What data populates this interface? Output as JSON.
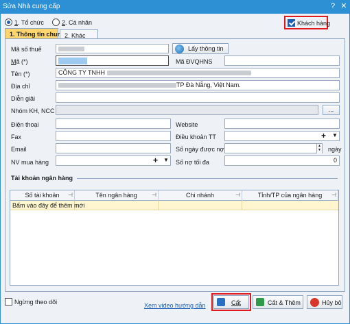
{
  "window": {
    "title": "Sửa Nhà cung cấp",
    "help": "?",
    "close": "✕"
  },
  "type_radio": {
    "option1": {
      "num": "1",
      "text": ". Tổ chức"
    },
    "option2": {
      "num": "2",
      "text": ". Cá nhân"
    }
  },
  "customer_checkbox": {
    "label": "Khách hàng",
    "checked": true
  },
  "tabs": [
    {
      "label": "1. Thông tin chung"
    },
    {
      "label": "2. Khác"
    }
  ],
  "form": {
    "tax_code": {
      "label": "Mã số thuế",
      "value": ""
    },
    "code": {
      "label": "Mã (*)",
      "value": ""
    },
    "lookup_button": "Lấy thông tin",
    "unit_code": {
      "label": "Mã ĐVQHNS",
      "value": ""
    },
    "name": {
      "label": "Tên (*)",
      "value": "CÔNG TY TNHH"
    },
    "address": {
      "label": "Địa chỉ",
      "value": "TP Đà Nẵng, Việt Nam."
    },
    "note": {
      "label": "Diễn giải",
      "value": ""
    },
    "group": {
      "label": "Nhóm KH, NCC",
      "value": "",
      "button": "..."
    },
    "phone": {
      "label": "Điện thoại",
      "value": ""
    },
    "website": {
      "label": "Website",
      "value": ""
    },
    "fax": {
      "label": "Fax",
      "value": ""
    },
    "payment_terms": {
      "label": "Điều khoản TT",
      "value": ""
    },
    "email": {
      "label": "Email",
      "value": ""
    },
    "debt_days": {
      "label": "Số ngày được nợ",
      "value": "",
      "unit": "ngày"
    },
    "purchaser": {
      "label": "NV mua hàng",
      "value": ""
    },
    "max_debt": {
      "label": "Số nợ tối đa",
      "value": "0"
    }
  },
  "bank_section": {
    "title": "Tài khoản ngân hàng",
    "columns": [
      "Số tài khoản",
      "Tên ngân hàng",
      "Chi nhánh",
      "Tỉnh/TP của ngân hàng"
    ],
    "pin_glyph": "⊣",
    "new_row_text": "Bấm vào đây để thêm mới"
  },
  "footer": {
    "stop_tracking": "Ngừng theo dõi",
    "video_link": "Xem video hướng dẫn",
    "save": "Cất",
    "save_add": "Cất & Thêm",
    "cancel": "Hủy bỏ"
  },
  "colors": {
    "accent": "#2d8fd4",
    "highlight": "#e0191f",
    "active_tab": "#ffd56e",
    "new_row": "#fff6cf"
  }
}
